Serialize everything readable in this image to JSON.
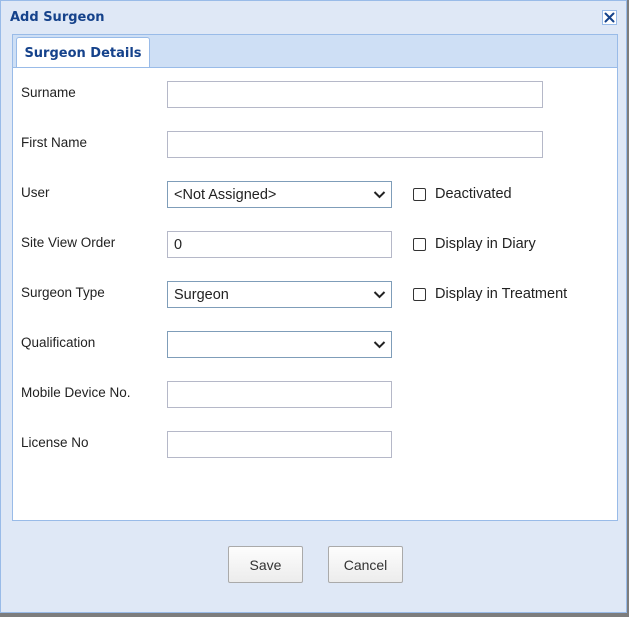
{
  "dialog": {
    "title": "Add Surgeon"
  },
  "icons": {
    "close": "close-icon",
    "chevron": "chevron-down-icon"
  },
  "tabs": [
    {
      "label": "Surgeon Details",
      "active": true
    }
  ],
  "form": {
    "surname": {
      "label": "Surname",
      "value": ""
    },
    "first_name": {
      "label": "First Name",
      "value": ""
    },
    "user": {
      "label": "User",
      "value": "<Not Assigned>"
    },
    "site_view_order": {
      "label": "Site View Order",
      "value": "0"
    },
    "surgeon_type": {
      "label": "Surgeon Type",
      "value": "Surgeon"
    },
    "qualification": {
      "label": "Qualification",
      "value": ""
    },
    "mobile_device_no": {
      "label": "Mobile Device No.",
      "value": ""
    },
    "license_no": {
      "label": "License No",
      "value": ""
    }
  },
  "checkboxes": {
    "deactivated": {
      "label": "Deactivated",
      "checked": false
    },
    "display_in_diary": {
      "label": "Display in Diary",
      "checked": false
    },
    "display_in_treatment": {
      "label": "Display in Treatment",
      "checked": false
    }
  },
  "buttons": {
    "save": "Save",
    "cancel": "Cancel"
  },
  "colors": {
    "title_text": "#15428b",
    "dialog_bg": "#dfe8f6",
    "border": "#99bbe8"
  }
}
